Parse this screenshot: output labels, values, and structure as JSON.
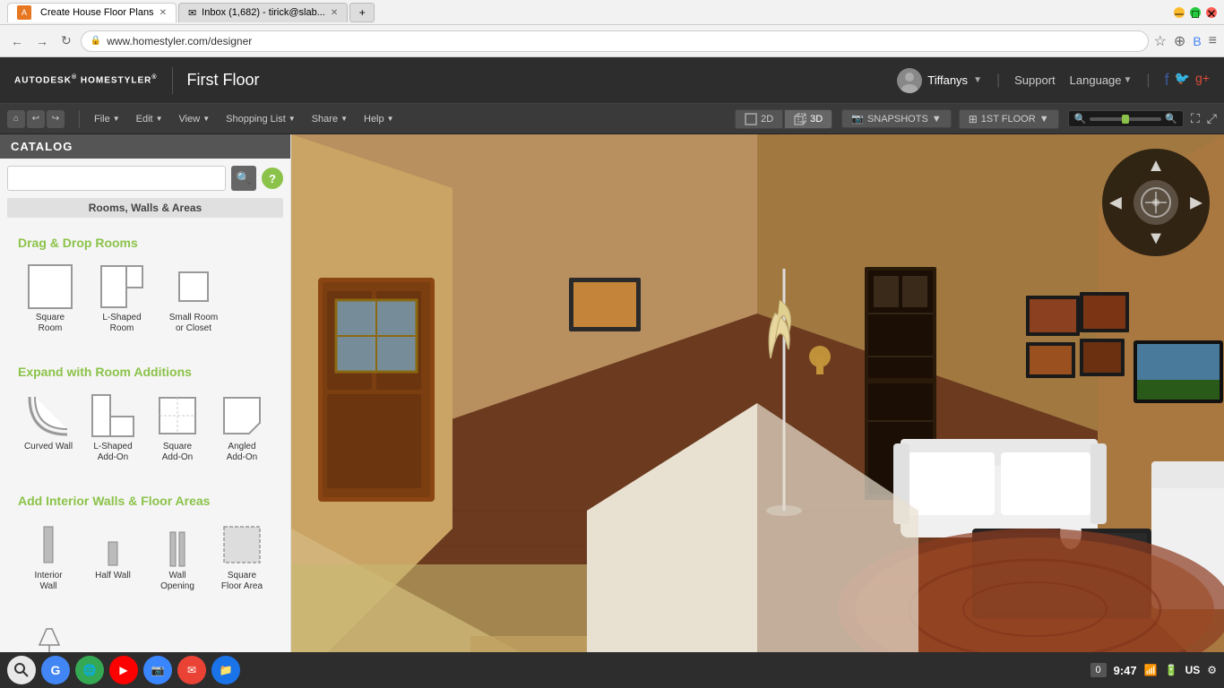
{
  "browser": {
    "tab1": {
      "title": "Create House Floor Plans",
      "active": true
    },
    "tab2": {
      "title": "Inbox (1,682) - tirick@slab...",
      "active": false
    },
    "address": "www.homestyler.com/designer",
    "lock_icon": "🔒"
  },
  "header": {
    "logo": "AUTODESK® HOMESTYLER®",
    "floor_name": "First Floor",
    "user_name": "Tiffanys",
    "support": "Support",
    "language": "Language"
  },
  "toolbar": {
    "file": "File",
    "edit": "Edit",
    "view": "View",
    "shopping_list": "Shopping List",
    "share": "Share",
    "help": "Help",
    "view_2d": "2D",
    "view_3d": "3D",
    "snapshots": "SNAPSHOTS",
    "floor": "1ST FLOOR"
  },
  "sidebar": {
    "title": "CATALOG",
    "section_label": "Rooms, Walls & Areas",
    "search_placeholder": "",
    "sections": {
      "drag_drop": "Drag & Drop Rooms",
      "expand": "Expand with Room Additions",
      "interior": "Add Interior Walls & Floor Areas"
    },
    "room_items": [
      {
        "label": "Square\nRoom",
        "shape": "square"
      },
      {
        "label": "L-Shaped\nRoom",
        "shape": "l-shaped"
      },
      {
        "label": "Small Room\nor Closet",
        "shape": "small"
      }
    ],
    "addition_items": [
      {
        "label": "Curved Wall",
        "shape": "curved"
      },
      {
        "label": "L-Shaped\nAdd-On",
        "shape": "l-add"
      },
      {
        "label": "Square\nAdd-On",
        "shape": "square-add"
      },
      {
        "label": "Angled\nAdd-On",
        "shape": "angled"
      }
    ],
    "wall_items": [
      {
        "label": "Interior\nWall",
        "shape": "interior-wall"
      },
      {
        "label": "Half Wall",
        "shape": "half-wall"
      },
      {
        "label": "Wall\nOpening",
        "shape": "wall-opening"
      },
      {
        "label": "Square\nFloor Area",
        "shape": "floor-area"
      }
    ]
  },
  "taskbar": {
    "apps": [
      "🔍",
      "G",
      "🌐",
      "▶",
      "📷",
      "✉",
      "📁"
    ],
    "time": "9:47",
    "tray_badge": "0",
    "region": "US"
  }
}
